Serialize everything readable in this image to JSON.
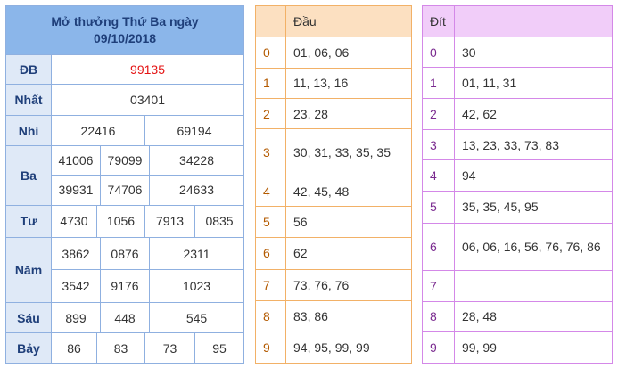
{
  "results": {
    "title_line1": "Mở thưởng Thứ Ba ngày",
    "title_line2": "09/10/2018",
    "rows": {
      "db": {
        "label": "ĐB",
        "values": [
          "99135"
        ]
      },
      "nhat": {
        "label": "Nhất",
        "values": [
          "03401"
        ]
      },
      "nhi": {
        "label": "Nhì",
        "values": [
          "22416",
          "69194"
        ]
      },
      "ba": {
        "label": "Ba",
        "values": [
          "41006",
          "79099",
          "34228",
          "39931",
          "74706",
          "24633"
        ]
      },
      "tu": {
        "label": "Tư",
        "values": [
          "4730",
          "1056",
          "7913",
          "0835"
        ]
      },
      "nam": {
        "label": "Năm",
        "values": [
          "3862",
          "0876",
          "2311",
          "3542",
          "9176",
          "1023"
        ]
      },
      "sau": {
        "label": "Sáu",
        "values": [
          "899",
          "448",
          "545"
        ]
      },
      "bay": {
        "label": "Bảy",
        "values": [
          "86",
          "83",
          "73",
          "95"
        ]
      }
    },
    "colors": {
      "header_bg": "#8bb6ea",
      "label_bg": "#dfe9f7",
      "special_prize": "#e41414"
    }
  },
  "dau": {
    "header": "Đầu",
    "rows": [
      {
        "key": "0",
        "val": "01, 06, 06"
      },
      {
        "key": "1",
        "val": "11, 13, 16"
      },
      {
        "key": "2",
        "val": "23, 28"
      },
      {
        "key": "3",
        "val": "30, 31, 33, 35, 35"
      },
      {
        "key": "4",
        "val": "42, 45, 48"
      },
      {
        "key": "5",
        "val": "56"
      },
      {
        "key": "6",
        "val": "62"
      },
      {
        "key": "7",
        "val": "73, 76, 76"
      },
      {
        "key": "8",
        "val": "83, 86"
      },
      {
        "key": "9",
        "val": "94, 95, 99, 99"
      }
    ]
  },
  "dit": {
    "header": "Đít",
    "rows": [
      {
        "key": "0",
        "val": "30"
      },
      {
        "key": "1",
        "val": "01, 11, 31"
      },
      {
        "key": "2",
        "val": "42, 62"
      },
      {
        "key": "3",
        "val": "13, 23, 33, 73, 83"
      },
      {
        "key": "4",
        "val": "94"
      },
      {
        "key": "5",
        "val": "35, 35, 45, 95"
      },
      {
        "key": "6",
        "val": "06, 06, 16, 56, 76, 76, 86"
      },
      {
        "key": "7",
        "val": ""
      },
      {
        "key": "8",
        "val": "28, 48"
      },
      {
        "key": "9",
        "val": "99, 99"
      }
    ]
  }
}
